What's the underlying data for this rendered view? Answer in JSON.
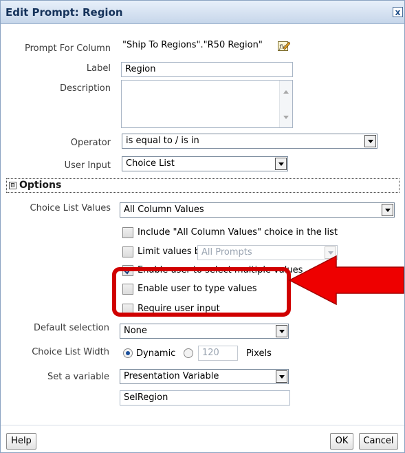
{
  "dialog": {
    "title": "Edit Prompt: Region",
    "close_glyph": "x"
  },
  "prompt_for_column": {
    "label": "Prompt For Column",
    "value": "\"Ship To Regions\".\"R50 Region\"",
    "edit_icon": "edit-formula-icon"
  },
  "label_field": {
    "label": "Label",
    "value": "Region"
  },
  "description": {
    "label": "Description",
    "value": ""
  },
  "operator": {
    "label": "Operator",
    "value": "is equal to / is in"
  },
  "user_input": {
    "label": "User Input",
    "value": "Choice List"
  },
  "options": {
    "expander": "⊟",
    "title": "Options",
    "choice_list_values": {
      "label": "Choice List Values",
      "value": "All Column Values"
    },
    "include_all": {
      "label": "Include \"All Column Values\" choice in the list",
      "checked": false
    },
    "limit_values": {
      "label": "Limit values by",
      "select_value": "All Prompts",
      "checked": false
    },
    "enable_multiple": {
      "label": "Enable user to select multiple values",
      "checked": true
    },
    "enable_type": {
      "label": "Enable user to type values",
      "checked": false
    },
    "require_input": {
      "label": "Require user input",
      "checked": false
    },
    "default_selection": {
      "label": "Default selection",
      "value": "None"
    },
    "choice_list_width": {
      "label": "Choice List Width",
      "dynamic_label": "Dynamic",
      "pixels_value": "120",
      "pixels_label": "Pixels",
      "selected": "Dynamic"
    },
    "set_variable": {
      "label": "Set a variable",
      "value": "Presentation Variable",
      "variable_name": "SelRegion"
    }
  },
  "buttons": {
    "help": "Help",
    "ok": "OK",
    "cancel": "Cancel"
  },
  "annotation": {
    "highlight_color": "#d00000",
    "arrow_color": "#ee0000"
  }
}
